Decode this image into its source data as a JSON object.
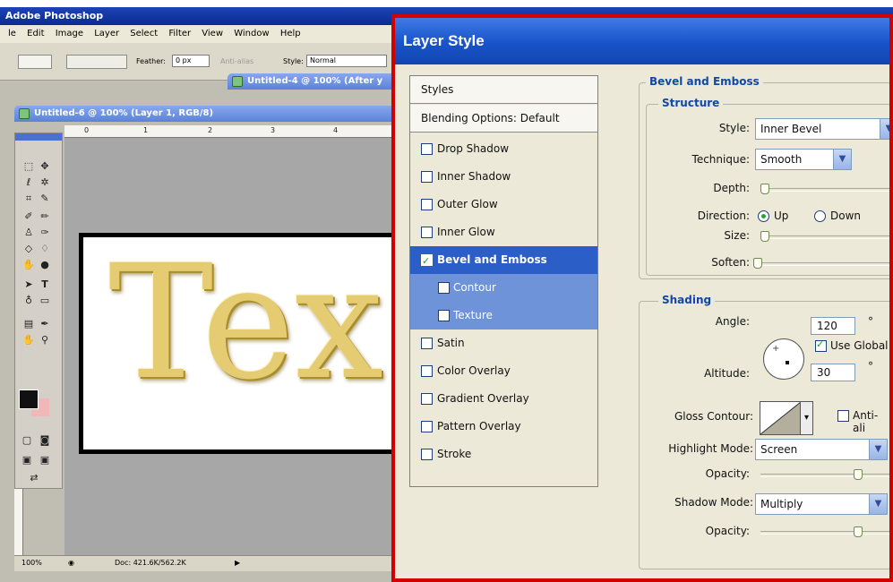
{
  "app": {
    "title": "Adobe Photoshop",
    "menu": [
      "le",
      "Edit",
      "Image",
      "Layer",
      "Select",
      "Filter",
      "View",
      "Window",
      "Help"
    ],
    "options_bar": {
      "feather_label": "Feather:",
      "feather_value": "0 px",
      "antialias_label": "Anti-alias",
      "style_label": "Style:",
      "style_value": "Normal"
    },
    "window2_title": "Untitled-4 @ 100% (After y",
    "window1_title": "Untitled-6 @ 100% (Layer 1, RGB/8)",
    "ruler_ticks": [
      "0",
      "1",
      "2",
      "3",
      "4"
    ],
    "canvas_text": "Tex",
    "status": {
      "zoom": "100%",
      "doc": "Doc: 421.6K/562.2K"
    }
  },
  "dialog": {
    "title": "Layer Style",
    "styles_header": "Styles",
    "blending_options": "Blending Options: Default",
    "effects": [
      {
        "label": "Drop Shadow",
        "checked": false
      },
      {
        "label": "Inner Shadow",
        "checked": false
      },
      {
        "label": "Outer Glow",
        "checked": false
      },
      {
        "label": "Inner Glow",
        "checked": false
      },
      {
        "label": "Bevel and Emboss",
        "checked": true,
        "selected": true
      },
      {
        "label": "Contour",
        "checked": false,
        "sub": true
      },
      {
        "label": "Texture",
        "checked": false,
        "sub": true
      },
      {
        "label": "Satin",
        "checked": false
      },
      {
        "label": "Color Overlay",
        "checked": false
      },
      {
        "label": "Gradient Overlay",
        "checked": false
      },
      {
        "label": "Pattern Overlay",
        "checked": false
      },
      {
        "label": "Stroke",
        "checked": false
      }
    ],
    "bevel": {
      "group_title": "Bevel and Emboss",
      "structure_title": "Structure",
      "style_label": "Style:",
      "style_value": "Inner Bevel",
      "technique_label": "Technique:",
      "technique_value": "Smooth",
      "depth_label": "Depth:",
      "depth_fraction": 0.0,
      "direction_label": "Direction:",
      "direction_up": "Up",
      "direction_down": "Down",
      "direction_selected": "Up",
      "size_label": "Size:",
      "size_fraction": 0.0,
      "soften_label": "Soften:",
      "soften_fraction": 0.0
    },
    "shading": {
      "title": "Shading",
      "angle_label": "Angle:",
      "angle_value": "120",
      "degree": "°",
      "use_global_label": "Use Global",
      "use_global_checked": true,
      "altitude_label": "Altitude:",
      "altitude_value": "30",
      "gloss_label": "Gloss Contour:",
      "antialias_label": "Anti-ali",
      "antialias_checked": false,
      "highlight_mode_label": "Highlight Mode:",
      "highlight_mode_value": "Screen",
      "opacity_label": "Opacity:",
      "highlight_opacity_fraction": 0.75,
      "shadow_mode_label": "Shadow Mode:",
      "shadow_mode_value": "Multiply",
      "shadow_opacity_fraction": 0.75
    }
  },
  "colors": {
    "accent_border": "#d40000",
    "selection_blue": "#2c5ec7",
    "section_title": "#1048a8"
  }
}
